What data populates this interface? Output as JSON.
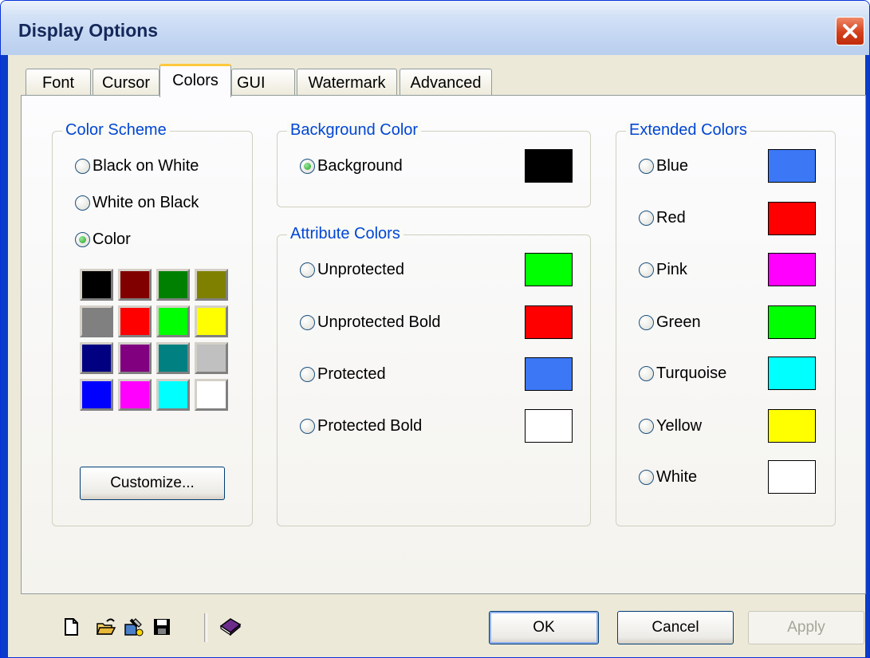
{
  "window": {
    "title": "Display Options"
  },
  "tabs": [
    {
      "label": "Font",
      "active": false
    },
    {
      "label": "Cursor",
      "active": false
    },
    {
      "label": "Colors",
      "active": true
    },
    {
      "label": "GUI",
      "active": false
    },
    {
      "label": "Watermark",
      "active": false
    },
    {
      "label": "Advanced",
      "active": false
    }
  ],
  "color_scheme": {
    "label": "Color Scheme",
    "options": [
      {
        "label": "Black on White",
        "selected": false
      },
      {
        "label": "White on Black",
        "selected": false
      },
      {
        "label": "Color",
        "selected": true
      }
    ],
    "palette": [
      "#000000",
      "#800000",
      "#008000",
      "#808000",
      "#808080",
      "#ff0000",
      "#00ff00",
      "#ffff00",
      "#000080",
      "#800080",
      "#008080",
      "#c0c0c0",
      "#0000ff",
      "#ff00ff",
      "#00ffff",
      "#ffffff"
    ],
    "customize_label": "Customize..."
  },
  "background_color": {
    "label": "Background Color",
    "items": [
      {
        "label": "Background",
        "selected": true,
        "color": "#000000"
      }
    ]
  },
  "attribute_colors": {
    "label": "Attribute Colors",
    "items": [
      {
        "label": "Unprotected",
        "selected": false,
        "color": "#00ff00"
      },
      {
        "label": "Unprotected Bold",
        "selected": false,
        "color": "#ff0000"
      },
      {
        "label": "Protected",
        "selected": false,
        "color": "#3c78f5"
      },
      {
        "label": "Protected Bold",
        "selected": false,
        "color": "#ffffff"
      }
    ]
  },
  "extended_colors": {
    "label": "Extended Colors",
    "items": [
      {
        "label": "Blue",
        "selected": false,
        "color": "#3c78f5"
      },
      {
        "label": "Red",
        "selected": false,
        "color": "#ff0000"
      },
      {
        "label": "Pink",
        "selected": false,
        "color": "#ff00ff"
      },
      {
        "label": "Green",
        "selected": false,
        "color": "#00ff00"
      },
      {
        "label": "Turquoise",
        "selected": false,
        "color": "#00ffff"
      },
      {
        "label": "Yellow",
        "selected": false,
        "color": "#ffff00"
      },
      {
        "label": "White",
        "selected": false,
        "color": "#ffffff"
      }
    ]
  },
  "toolbar": {
    "icons": [
      "new-file-icon",
      "open-folder-icon",
      "tools-icon",
      "save-icon",
      "book-icon"
    ]
  },
  "buttons": {
    "ok": "OK",
    "cancel": "Cancel",
    "apply": "Apply",
    "apply_enabled": false
  }
}
